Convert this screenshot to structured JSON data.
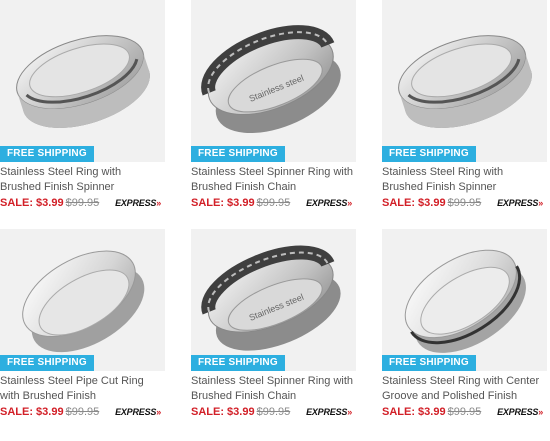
{
  "products": [
    {
      "variant": "brushed-spinner",
      "badge": "FREE SHIPPING",
      "title": "Stainless Steel Ring with Brushed Finish Spinner",
      "sale_label": "SALE: $3.99",
      "original_price": "$99.95",
      "shipping_brand": "EXPRESS",
      "shipping_arrow": "»"
    },
    {
      "variant": "chain-spinner",
      "badge": "FREE SHIPPING",
      "title": "Stainless Steel Spinner Ring with Brushed Finish Chain",
      "sale_label": "SALE: $3.99",
      "original_price": "$99.95",
      "shipping_brand": "EXPRESS",
      "shipping_arrow": "»",
      "engraving": "Stainless steel"
    },
    {
      "variant": "brushed-spinner",
      "badge": "FREE SHIPPING",
      "title": "Stainless Steel Ring with Brushed Finish Spinner",
      "sale_label": "SALE: $3.99",
      "original_price": "$99.95",
      "shipping_brand": "EXPRESS",
      "shipping_arrow": "»"
    },
    {
      "variant": "pipe-cut",
      "badge": "FREE SHIPPING",
      "title": "Stainless Steel Pipe Cut Ring with Brushed Finish",
      "sale_label": "SALE: $3.99",
      "original_price": "$99.95",
      "shipping_brand": "EXPRESS",
      "shipping_arrow": "»"
    },
    {
      "variant": "chain-spinner",
      "badge": "FREE SHIPPING",
      "title": "Stainless Steel Spinner Ring with Brushed Finish Chain",
      "sale_label": "SALE: $3.99",
      "original_price": "$99.95",
      "shipping_brand": "EXPRESS",
      "shipping_arrow": "»",
      "engraving": "Stainless steel"
    },
    {
      "variant": "center-groove",
      "badge": "FREE SHIPPING",
      "title": "Stainless Steel Ring with Center Groove and Polished Finish",
      "sale_label": "SALE: $3.99",
      "original_price": "$99.95",
      "shipping_brand": "EXPRESS",
      "shipping_arrow": "»"
    }
  ],
  "colors": {
    "badge_bg": "#2dafe0",
    "sale": "#d21f27",
    "tile_bg": "#f1f1f1"
  }
}
